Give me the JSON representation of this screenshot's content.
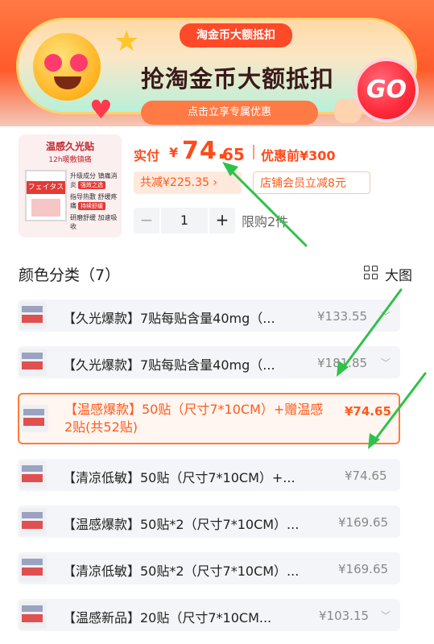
{
  "banner": {
    "tag": "淘金币大额抵扣",
    "title": "抢淘金币大额抵扣",
    "subtitle": "点击立享专属优惠",
    "go": "GO"
  },
  "product": {
    "thumb_title": "温感久光贴",
    "thumb_subtitle": "12h暖敷镇痛",
    "thumb_brand": "フェイタス",
    "thumb_features": [
      "升级成分 镇痛消炎",
      "指导热敷 舒缓疼痛",
      "研磨舒缓 加速吸收"
    ],
    "thumb_badges": [
      "强效之选",
      "持续舒缓"
    ],
    "price_label": "实付",
    "currency": "¥",
    "price_int": "74.",
    "price_dec": "65",
    "price_before": "优惠前¥300",
    "save_chip": "共减¥225.35 ›",
    "member_chip": "店铺会员立减8元",
    "qty_minus": "−",
    "qty": "1",
    "qty_plus": "+",
    "limit": "限购2件"
  },
  "section": {
    "title": "颜色分类（7）",
    "bigpic": "大图"
  },
  "options": [
    {
      "label": "【久光爆款】7贴每贴含量40mg（...",
      "price": "¥133.55",
      "selected": false
    },
    {
      "label": "【久光爆款】7贴每贴含量40mg（...",
      "price": "¥181.85",
      "selected": false
    },
    {
      "label": "【温感爆款】50贴（尺寸7*10CM）+赠温感2贴(共52贴)",
      "price": "¥74.65",
      "selected": true
    },
    {
      "label": "【清凉低敏】50贴（尺寸7*10CM）+...",
      "price": "¥74.65",
      "selected": false
    },
    {
      "label": "【温感爆款】50贴*2（尺寸7*10CM）...",
      "price": "¥169.65",
      "selected": false
    },
    {
      "label": "【清凉低敏】50贴*2（尺寸7*10CM）...",
      "price": "¥169.65",
      "selected": false
    },
    {
      "label": "【温感新品】20贴（尺寸7*10CM...",
      "price": "¥103.15",
      "selected": false
    }
  ],
  "colors": {
    "accent": "#ff5a1a",
    "annotation_arrow": "#2ec24a"
  }
}
